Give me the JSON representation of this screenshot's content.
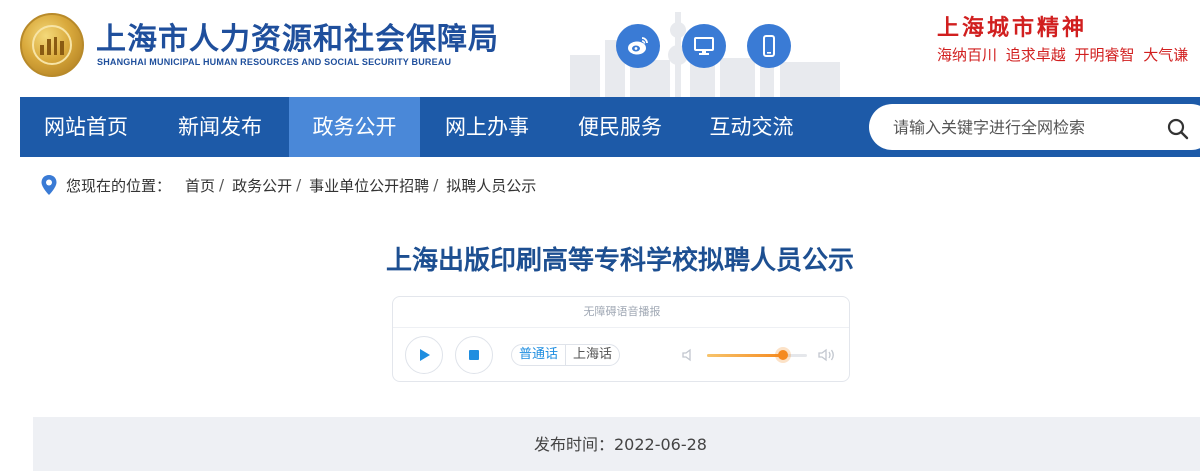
{
  "header": {
    "site_title": "上海市人力资源和社会保障局",
    "site_subtitle": "SHANGHAI MUNICIPAL HUMAN RESOURCES AND SOCIAL SECURITY BUREAU",
    "icons": [
      "weibo-icon",
      "monitor-icon",
      "mobile-icon"
    ],
    "spirit_title": "上海城市精神",
    "spirit_slogan": "海纳百川 追求卓越 开明睿智 大气谦"
  },
  "nav": {
    "items": [
      {
        "label": "网站首页",
        "active": false
      },
      {
        "label": "新闻发布",
        "active": false
      },
      {
        "label": "政务公开",
        "active": true
      },
      {
        "label": "网上办事",
        "active": false
      },
      {
        "label": "便民服务",
        "active": false
      },
      {
        "label": "互动交流",
        "active": false
      }
    ],
    "search_placeholder": "请输入关键字进行全网检索"
  },
  "breadcrumb": {
    "label": "您现在的位置：",
    "items": [
      "首页",
      "政务公开",
      "事业单位公开招聘",
      "拟聘人员公示"
    ]
  },
  "article": {
    "title": "上海出版印刷高等专科学校拟聘人员公示",
    "publish_time": "发布时间：2022-06-28"
  },
  "player": {
    "label": "无障碍语音播报",
    "dialects": [
      "普通话",
      "上海话"
    ],
    "selected_dialect": "普通话",
    "volume": 0.76
  },
  "colors": {
    "nav_bg": "#1d5aa8",
    "nav_active": "#4a88d8",
    "title_blue": "#1d4f91",
    "accent_red": "#d11f1f",
    "player_accent": "#1f8ee0",
    "volume": "#f58a1f"
  }
}
